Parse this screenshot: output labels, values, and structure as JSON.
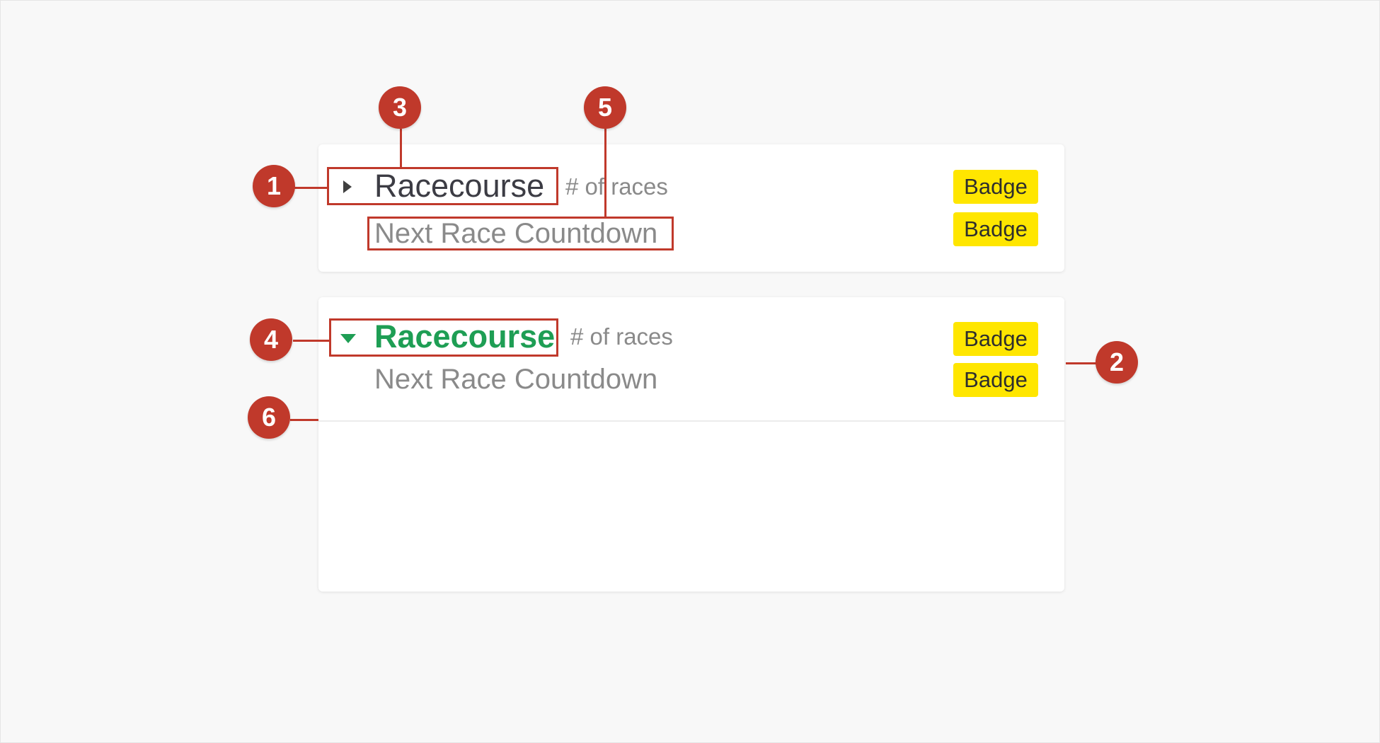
{
  "cards": [
    {
      "state": "collapsed",
      "title": "Racecourse",
      "count_label": "# of races",
      "subtitle": "Next Race Countdown",
      "badges": [
        "Badge",
        "Badge"
      ]
    },
    {
      "state": "expanded",
      "title": "Racecourse",
      "count_label": "# of races",
      "subtitle": "Next Race Countdown",
      "badges": [
        "Badge",
        "Badge"
      ]
    }
  ],
  "annotations": [
    "1",
    "2",
    "3",
    "4",
    "5",
    "6"
  ],
  "icons": {
    "collapsed_chevron": "chevron-right-icon",
    "expanded_chevron": "chevron-down-icon"
  },
  "colors": {
    "background": "#f8f8f8",
    "card": "#ffffff",
    "title": "#3c3c44",
    "title_active": "#1e9e54",
    "muted_text": "#8a8a8a",
    "badge": "#ffe600",
    "annotation": "#c0392b"
  }
}
